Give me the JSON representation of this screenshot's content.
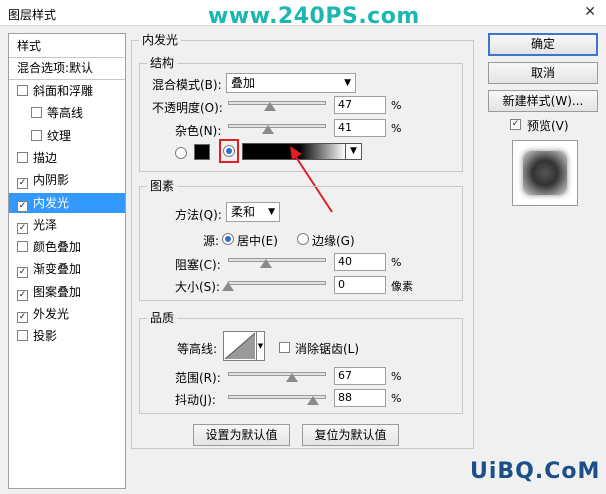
{
  "window": {
    "title": "图层样式",
    "close": "✕",
    "watermark": "www.240PS.com"
  },
  "left_panel": {
    "header": "样式",
    "blending": "混合选项:默认",
    "items": [
      {
        "label": "斜面和浮雕",
        "checked": false,
        "indent": false
      },
      {
        "label": "等高线",
        "checked": false,
        "indent": true
      },
      {
        "label": "纹理",
        "checked": false,
        "indent": true
      },
      {
        "label": "描边",
        "checked": false,
        "indent": false
      },
      {
        "label": "内阴影",
        "checked": true,
        "indent": false
      },
      {
        "label": "内发光",
        "checked": true,
        "indent": false,
        "selected": true
      },
      {
        "label": "光泽",
        "checked": true,
        "indent": false
      },
      {
        "label": "颜色叠加",
        "checked": false,
        "indent": false
      },
      {
        "label": "渐变叠加",
        "checked": true,
        "indent": false
      },
      {
        "label": "图案叠加",
        "checked": true,
        "indent": false
      },
      {
        "label": "外发光",
        "checked": true,
        "indent": false
      },
      {
        "label": "投影",
        "checked": false,
        "indent": false
      }
    ]
  },
  "main": {
    "section_title": "内发光",
    "structure": {
      "title": "结构",
      "blend_mode_label": "混合模式(B):",
      "blend_mode_value": "叠加",
      "opacity_label": "不透明度(O):",
      "opacity_value": "47",
      "opacity_unit": "%",
      "noise_label": "杂色(N):",
      "noise_value": "41",
      "noise_unit": "%",
      "swatch_color": "#000000"
    },
    "elements": {
      "title": "图素",
      "method_label": "方法(Q):",
      "method_value": "柔和",
      "source_label": "源:",
      "source_center": "居中(E)",
      "source_edge": "边缘(G)",
      "choke_label": "阻塞(C):",
      "choke_value": "40",
      "choke_unit": "%",
      "size_label": "大小(S):",
      "size_value": "0",
      "size_unit": "像素"
    },
    "quality": {
      "title": "品质",
      "contour_label": "等高线:",
      "antialias_label": "消除锯齿(L)",
      "range_label": "范围(R):",
      "range_value": "67",
      "range_unit": "%",
      "jitter_label": "抖动(J):",
      "jitter_value": "88",
      "jitter_unit": "%"
    },
    "set_default": "设置为默认值",
    "reset_default": "复位为默认值"
  },
  "right": {
    "ok": "确定",
    "cancel": "取消",
    "new_style": "新建样式(W)...",
    "preview": "预览(V)"
  },
  "footer_watermark": "UiBQ.CoM",
  "colors": {
    "accent": "#3399ff",
    "arrow": "#e02020",
    "watermark": "#1bb7b0"
  }
}
